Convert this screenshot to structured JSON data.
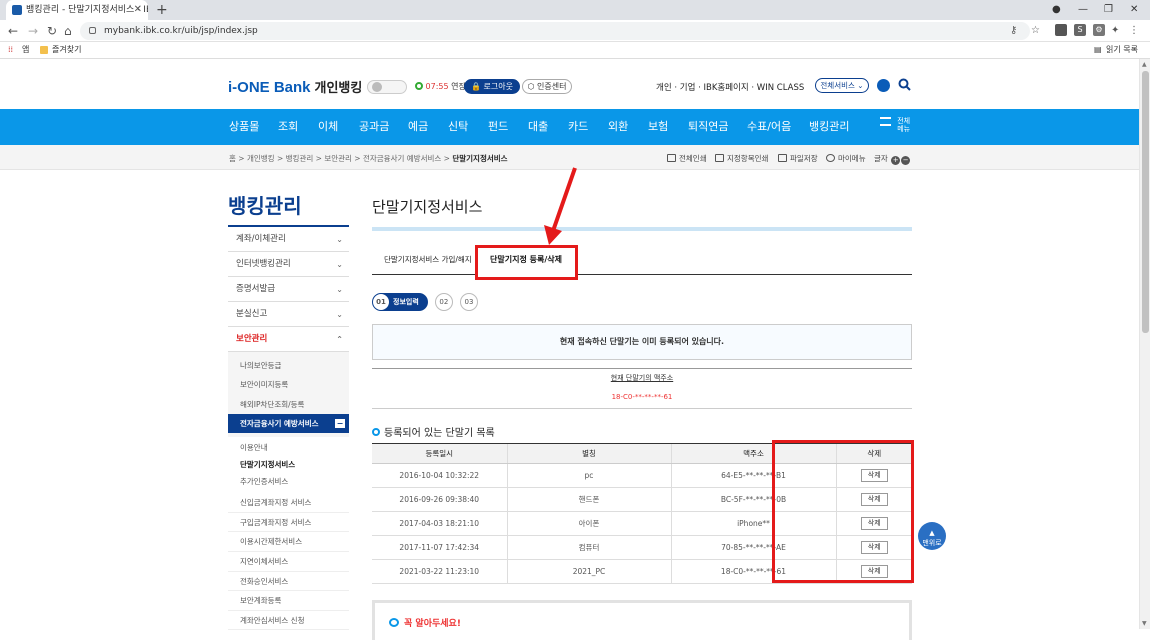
{
  "browser": {
    "tab_title": "뱅킹관리 - 단말기지정서비스 - IBK",
    "url": "mybank.ibk.co.kr/uib/jsp/index.jsp",
    "bookmarks": [
      "앱",
      "즐겨찾기"
    ],
    "reading_list": "읽기 목록",
    "extension_label": "S"
  },
  "header": {
    "logo": "i-ONE Bank",
    "logo_sub": "개인뱅킹",
    "timer": "07:55",
    "extend": "연장",
    "logout": "로그아웃",
    "cert": "인증센터",
    "links": "개인 · 기업 · IBK홈페이지 · WIN CLASS",
    "all_services": "전체서비스"
  },
  "gnb": {
    "items": [
      "상품몰",
      "조회",
      "이체",
      "공과금",
      "예금",
      "신탁",
      "펀드",
      "대출",
      "카드",
      "외환",
      "보험",
      "퇴직연금",
      "수표/어음",
      "뱅킹관리"
    ],
    "all_menu_1": "전체",
    "all_menu_2": "메뉴"
  },
  "breadcrumb": {
    "items": [
      "홈",
      "개인뱅킹",
      "뱅킹관리",
      "보안관리",
      "전자금융사기 예방서비스",
      "단말기지정서비스"
    ],
    "tools": [
      "전체인쇄",
      "지정항목인쇄",
      "파일저장",
      "마이메뉴"
    ],
    "font_label": "글자"
  },
  "lnb": {
    "title": "뱅킹관리",
    "menus": [
      "계좌/이체관리",
      "인터넷뱅킹관리",
      "증명서발급",
      "분실신고"
    ],
    "open_menu": "보안관리",
    "sub_items": [
      "나의보안등급",
      "보안이미지등록",
      "해외IP차단조회/등록"
    ],
    "selected": "전자금융사기 예방서비스",
    "selected_sub": [
      "이용안내",
      "단말기지정서비스",
      "추가인증서비스"
    ],
    "rest": [
      "신입금계좌지정 서비스",
      "구입금계좌지정 서비스",
      "이용시간제한서비스",
      "지연이체서비스",
      "전화승인서비스",
      "보안계좌등록",
      "계좌안심서비스 신청"
    ]
  },
  "main": {
    "title": "단말기지정서비스",
    "tab1": "단말기지정서비스 가입/해지",
    "tab2": "단말기지정 등록/삭제",
    "steps": [
      "01",
      "정보입력",
      "02",
      "03"
    ],
    "notice": "현재 접속하신 단말기는 이미 등록되어 있습니다.",
    "mac_label": "현재 단말기의 맥주소",
    "mac_value": "18-C0-**-**-**-61",
    "list_title": "등록되어 있는 단말기 목록",
    "table": {
      "headers": [
        "등록일시",
        "별칭",
        "맥주소",
        "삭제"
      ],
      "rows": [
        [
          "2016-10-04 10:32:22",
          "pc",
          "64-E5-**-**-**-B1",
          "삭제"
        ],
        [
          "2016-09-26 09:38:40",
          "핸드폰",
          "BC-5F-**-**-**-0B",
          "삭제"
        ],
        [
          "2017-04-03 18:21:10",
          "아이폰",
          "iPhone**",
          "삭제"
        ],
        [
          "2017-11-07 17:42:34",
          "컴퓨터",
          "70-85-**-**-**-AE",
          "삭제"
        ],
        [
          "2021-03-22 11:23:10",
          "2021_PC",
          "18-C0-**-**-**-61",
          "삭제"
        ]
      ]
    },
    "info_title": "꼭 알아두세요!",
    "top_button": "맨위로"
  },
  "colors": {
    "brand": "#0a97e8",
    "navy": "#0b3f8f",
    "annotation": "#e41a1a"
  }
}
